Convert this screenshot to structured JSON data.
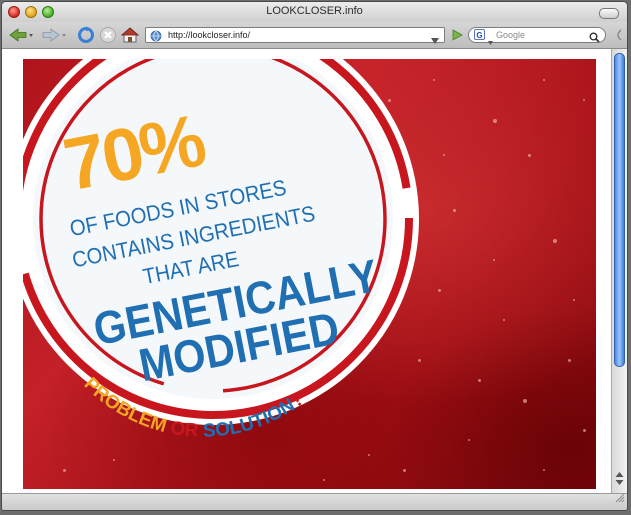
{
  "window": {
    "title": "LOOKCLOSER.info"
  },
  "toolbar": {
    "url": "http://lookcloser.info/",
    "search_placeholder": "Google"
  },
  "badge": {
    "percent": "70%",
    "line1": "OF FOODS IN STORES",
    "line2": "CONTAINS INGREDIENTS",
    "line3": "THAT ARE",
    "headline1": "GENETICALLY",
    "headline2": "MODIFIED",
    "problem": "PROBLEM",
    "or": "OR",
    "solution": "SOLUTION",
    "question": "?"
  },
  "colors": {
    "orange": "#f5a623",
    "blue": "#1f6fb2",
    "red": "#c8161e",
    "badge_bg": "#f4f8fb"
  }
}
